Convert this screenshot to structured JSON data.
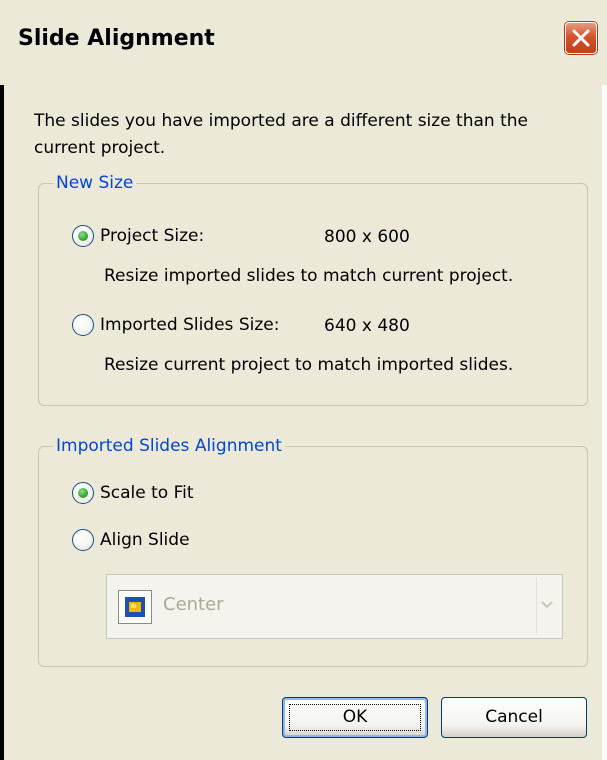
{
  "window": {
    "title": "Slide Alignment",
    "close_icon": "close-x-icon",
    "close_color": "#d4542d"
  },
  "intro_text": "The slides you have imported are a different size than the current project.",
  "new_size": {
    "legend": "New Size",
    "project_size": {
      "label": "Project Size:",
      "value": "800 x 600",
      "description": "Resize imported slides to match current project.",
      "checked": true
    },
    "imported_size": {
      "label": "Imported Slides Size:",
      "value": "640 x 480",
      "description": "Resize current project to match imported slides.",
      "checked": false
    }
  },
  "alignment": {
    "legend": "Imported Slides Alignment",
    "scale_to_fit": {
      "label": "Scale to Fit",
      "checked": true
    },
    "align_slide": {
      "label": "Align Slide",
      "checked": false
    },
    "dropdown": {
      "selected": "Center",
      "icon": "alignment-center-icon",
      "disabled": true
    }
  },
  "buttons": {
    "ok": "OK",
    "cancel": "Cancel"
  },
  "colors": {
    "legend_text": "#0046d5",
    "dialog_bg": "#ece9d8",
    "radio_check": "#36a535"
  }
}
